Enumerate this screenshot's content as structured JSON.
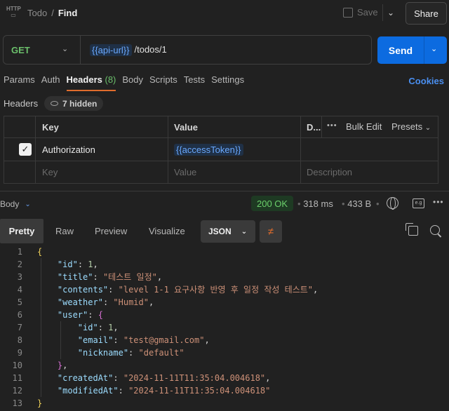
{
  "topbar": {
    "breadcrumb_parent": "Todo",
    "breadcrumb_sep": "/",
    "breadcrumb_current": "Find",
    "save_label": "Save",
    "share_label": "Share"
  },
  "request": {
    "method": "GET",
    "url_var": "{{api-url}}",
    "url_path": "/todos/1",
    "send_label": "Send"
  },
  "tabs": [
    {
      "label": "Params"
    },
    {
      "label": "Auth"
    },
    {
      "label": "Headers",
      "count": "(8)"
    },
    {
      "label": "Body"
    },
    {
      "label": "Scripts"
    },
    {
      "label": "Tests"
    },
    {
      "label": "Settings"
    }
  ],
  "cookies_label": "Cookies",
  "headers_section": {
    "label": "Headers",
    "hidden_label": "7 hidden",
    "columns": {
      "key": "Key",
      "value": "Value",
      "description": "D..."
    },
    "bulk_edit_label": "Bulk Edit",
    "presets_label": "Presets",
    "rows": [
      {
        "key": "Authorization",
        "value": "{{accessToken}}",
        "checked": true
      }
    ],
    "placeholders": {
      "key": "Key",
      "value": "Value",
      "description": "Description"
    }
  },
  "response": {
    "body_label": "Body",
    "status": "200 OK",
    "time": "318 ms",
    "size": "433 B",
    "status_color": "#6bd06b",
    "view_tabs": [
      "Pretty",
      "Raw",
      "Preview",
      "Visualize"
    ],
    "active_view": "Pretty",
    "format": "JSON",
    "body_lines": [
      "{",
      "\"id\": 1,",
      "\"title\": \"테스트 일정\",",
      "\"contents\": \"level 1-1 요구사항 반영 후 일정 작성 테스트\",",
      "\"weather\": \"Humid\",",
      "\"user\": {",
      "\"id\": 1,",
      "\"email\": \"test@gmail.com\",",
      "\"nickname\": \"default\"",
      "},",
      "\"createdAt\": \"2024-11-11T11:35:04.004618\",",
      "\"modifiedAt\": \"2024-11-11T11:35:04.004618\"",
      "}"
    ]
  },
  "colors": {
    "accent": "#e06c2c",
    "send": "#0c6be0",
    "method_get": "#6bbf6b",
    "link": "#4a8ff0"
  }
}
